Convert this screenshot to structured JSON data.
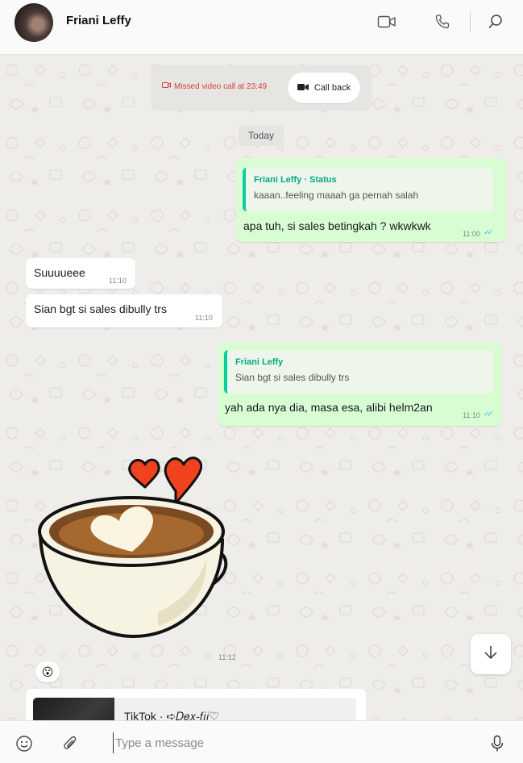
{
  "header": {
    "contact_name": "Friani Leffy",
    "icons": [
      "video-call-icon",
      "voice-call-icon",
      "search-icon"
    ]
  },
  "system": {
    "missed_call": "Missed video call at 23:49",
    "call_back": "Call back"
  },
  "date_divider": "Today",
  "messages": [
    {
      "direction": "out",
      "quote_author": "Friani Leffy · Status",
      "quote_text": "kaaan..feeling maaah ga pernah salah",
      "text": "apa tuh, si sales betingkah ? wkwkwk",
      "time": "11:00",
      "read": true
    },
    {
      "direction": "in",
      "text": "Suuuueee",
      "time": "11:10"
    },
    {
      "direction": "in",
      "text": "Sian bgt si sales dibully trs",
      "time": "11:10"
    },
    {
      "direction": "out",
      "quote_author": "Friani Leffy",
      "quote_text": "Sian bgt si sales dibully trs",
      "text": "yah ada nya dia, masa esa, alibi helm2an",
      "time": "11:10",
      "read": true
    },
    {
      "direction": "in",
      "type": "sticker",
      "sticker": "coffee-heart-sticker",
      "time": "11:12"
    }
  ],
  "reaction": "😮",
  "link_preview": {
    "title": "TikTok · ➪𝐷𝑒𝑥-𝑓𝑖𝑖♡"
  },
  "footer": {
    "placeholder": "Type a message",
    "icons": [
      "emoji-icon",
      "attach-icon",
      "mic-icon"
    ]
  },
  "colors": {
    "outgoing_bubble": "#d9fdd3",
    "incoming_bubble": "#ffffff",
    "quote_accent": "#06cf9c",
    "missed_call": "#d4413b",
    "read_ticks": "#53bdeb"
  }
}
